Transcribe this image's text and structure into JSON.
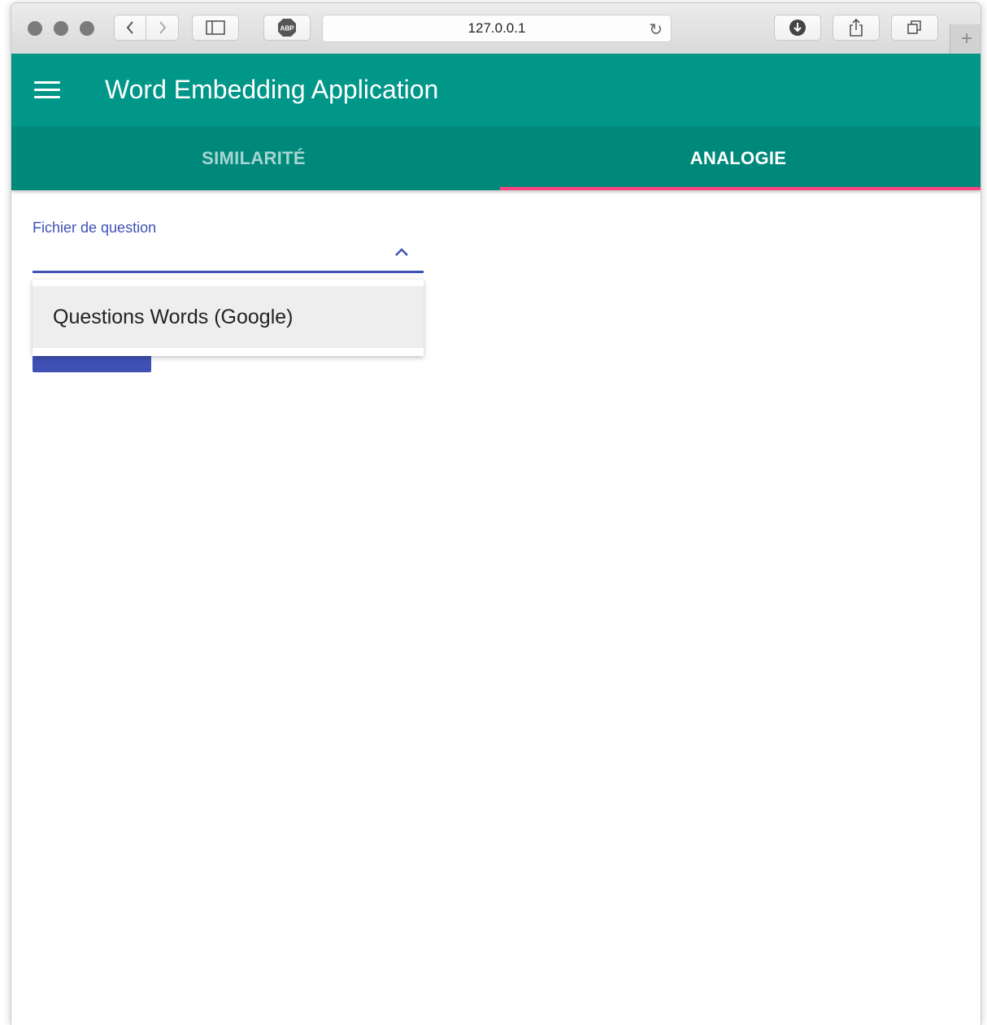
{
  "browser": {
    "url": "127.0.0.1",
    "icons": [
      "back-icon",
      "forward-icon",
      "sidebar-icon",
      "adblock-icon",
      "reload-icon",
      "download-icon",
      "share-icon",
      "tabs-icon",
      "new-tab-icon"
    ]
  },
  "app": {
    "title": "Word Embedding Application",
    "primary_color": "#009688",
    "accent_color": "#ff4081"
  },
  "tabs": [
    {
      "label": "SIMILARITÉ",
      "active": false
    },
    {
      "label": "ANALOGIE",
      "active": true
    }
  ],
  "form": {
    "select_label": "Fichier de question",
    "options": [
      {
        "label": "Questions Words (Google)"
      }
    ]
  }
}
